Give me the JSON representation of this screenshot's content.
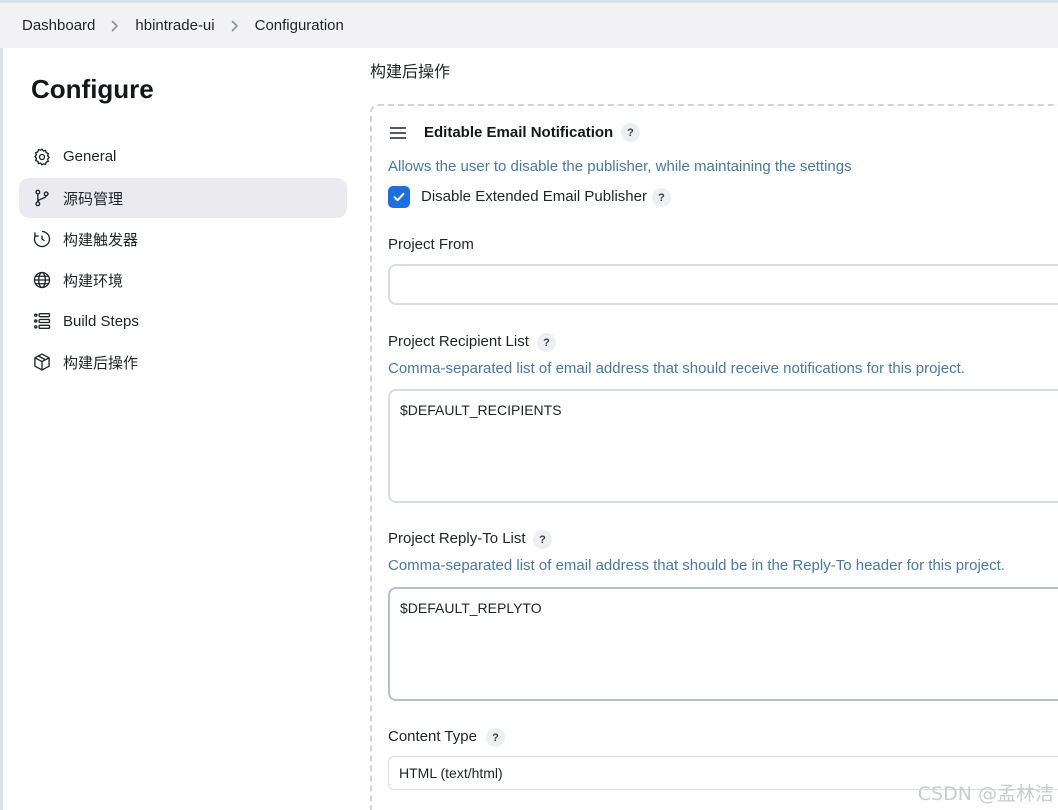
{
  "breadcrumbs": [
    {
      "label": "Dashboard"
    },
    {
      "label": "hbintrade-ui"
    },
    {
      "label": "Configuration"
    }
  ],
  "sidebar": {
    "title": "Configure",
    "items": [
      {
        "label": "General",
        "icon": "gear-icon"
      },
      {
        "label": "源码管理",
        "icon": "branch-icon",
        "active": true
      },
      {
        "label": "构建触发器",
        "icon": "clock-icon"
      },
      {
        "label": "构建环境",
        "icon": "globe-icon"
      },
      {
        "label": "Build Steps",
        "icon": "list-icon"
      },
      {
        "label": "构建后操作",
        "icon": "package-icon"
      }
    ]
  },
  "main": {
    "heading": "构建后操作",
    "section": {
      "title": "Editable Email Notification",
      "help": "?",
      "description": "Allows the user to disable the publisher, while maintaining the settings",
      "disable_checkbox": {
        "label": "Disable Extended Email Publisher",
        "checked": true
      },
      "project_from": {
        "label": "Project From",
        "value": ""
      },
      "recipient_list": {
        "label": "Project Recipient List",
        "description": "Comma-separated list of email address that should receive notifications for this project.",
        "value": "$DEFAULT_RECIPIENTS"
      },
      "reply_to": {
        "label": "Project Reply-To List",
        "description": "Comma-separated list of email address that should be in the Reply-To header for this project.",
        "value": "$DEFAULT_REPLYTO"
      },
      "content_type": {
        "label": "Content Type",
        "value": "HTML (text/html)"
      }
    }
  },
  "watermark": "CSDN @孟林洁",
  "colors": {
    "accent": "#1b6fe0",
    "description": "#4a78a3",
    "active_nav": "#ebebef"
  }
}
